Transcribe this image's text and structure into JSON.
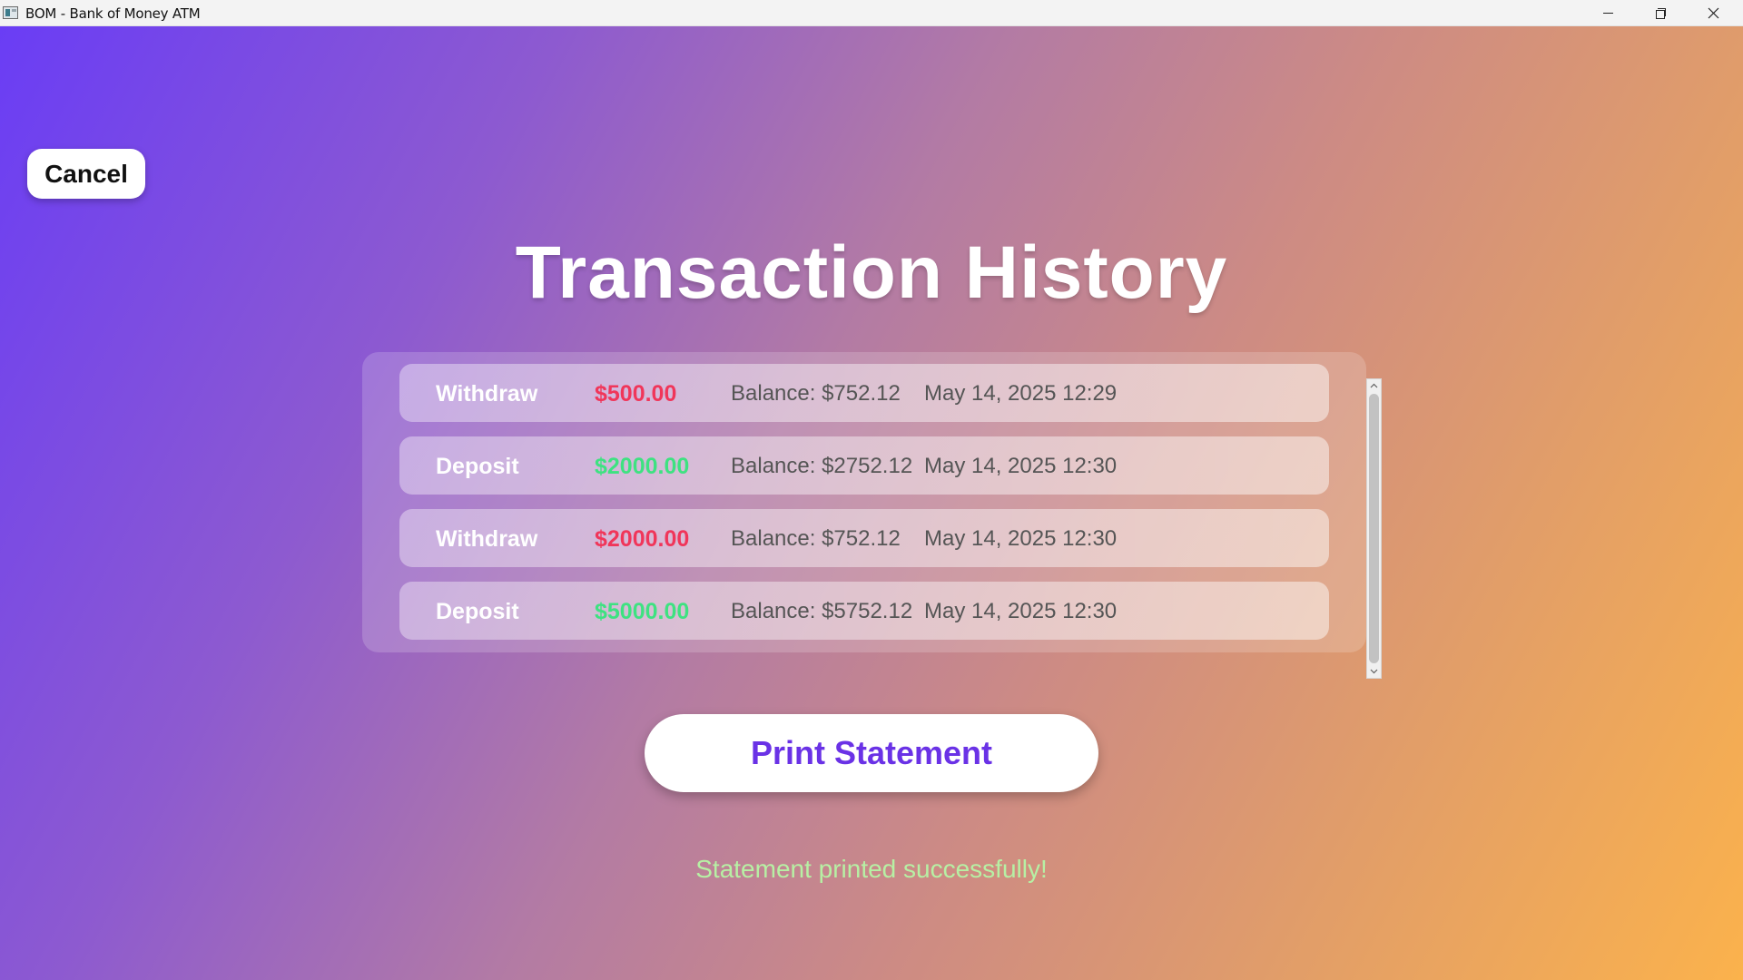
{
  "window": {
    "title": "BOM - Bank of Money ATM",
    "controls": [
      "minimize-icon",
      "restore-icon",
      "close-icon"
    ]
  },
  "header": {
    "cancel_label": "Cancel",
    "title": "Transaction History"
  },
  "transactions": [
    {
      "type": "Withdraw",
      "amount": "$500.00",
      "balance": "Balance: $752.12",
      "date": "May 14, 2025 12:29"
    },
    {
      "type": "Deposit",
      "amount": "$2000.00",
      "balance": "Balance: $2752.12",
      "date": "May 14, 2025 12:30"
    },
    {
      "type": "Withdraw",
      "amount": "$2000.00",
      "balance": "Balance: $752.12",
      "date": "May 14, 2025 12:30"
    },
    {
      "type": "Deposit",
      "amount": "$5000.00",
      "balance": "Balance: $5752.12",
      "date": "May 14, 2025 12:30"
    }
  ],
  "actions": {
    "print_label": "Print Statement"
  },
  "status": {
    "message": "Statement printed successfully!"
  },
  "colors": {
    "gradient_start": "#6a3df5",
    "gradient_end": "#fbb24c",
    "withdraw": "#f0365a",
    "deposit": "#3ee281",
    "print_text": "#6a32e6",
    "success": "#b7f0a4"
  }
}
